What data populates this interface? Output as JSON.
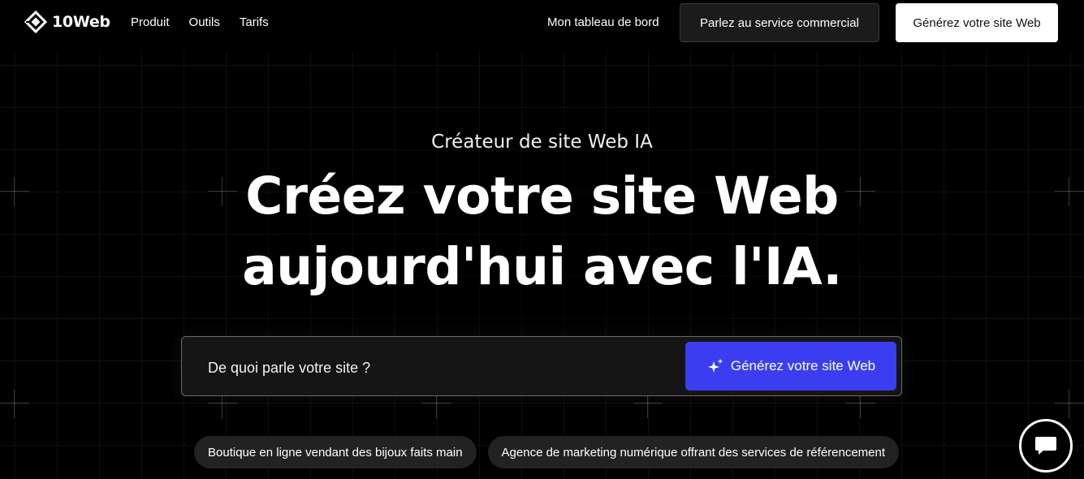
{
  "header": {
    "logo_text": "10Web",
    "nav": [
      {
        "label": "Produit"
      },
      {
        "label": "Outils"
      },
      {
        "label": "Tarifs"
      }
    ],
    "dashboard_label": "Mon tableau de bord",
    "sales_label": "Parlez au service commercial",
    "generate_label": "Générez votre site Web"
  },
  "hero": {
    "subtitle": "Créateur de site Web IA",
    "headline_line1": "Créez votre site Web",
    "headline_line2": "aujourd'hui avec l'IA.",
    "search_placeholder": "De quoi parle votre site ?",
    "generate_label": "Générez votre site Web",
    "suggestions": [
      "Boutique en ligne vendant des bijoux faits main",
      "Agence de marketing numérique offrant des services de référencement"
    ]
  },
  "icons": {
    "logo": "diamond-logo-icon",
    "generate": "sparkle-icon",
    "chat": "chat-bubble-icon"
  },
  "colors": {
    "background": "#000000",
    "accent": "#3b3ef0",
    "chip_bg": "#222222",
    "header_cta_bg": "#ffffff"
  }
}
